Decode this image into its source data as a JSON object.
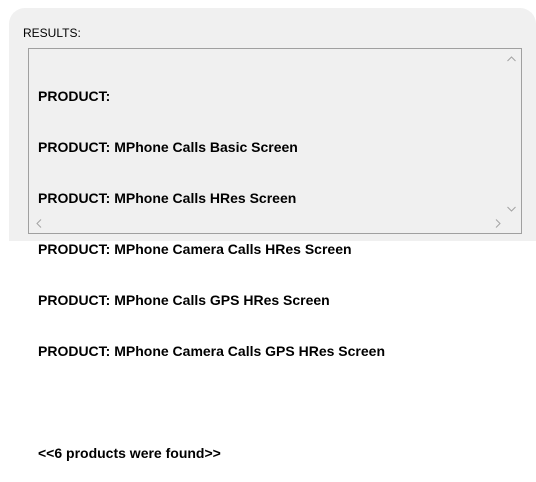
{
  "results": {
    "label": "RESULTS:",
    "lines": [
      "PRODUCT:",
      "PRODUCT: MPhone Calls Basic Screen",
      "PRODUCT: MPhone Calls HRes Screen",
      "PRODUCT: MPhone Camera Calls HRes Screen",
      "PRODUCT: MPhone Calls GPS HRes Screen",
      "PRODUCT: MPhone Camera Calls GPS HRes Screen",
      "",
      "<<6 products were found>>"
    ]
  },
  "scrollbar_icons": {
    "up": "chevron-up-icon",
    "down": "chevron-down-icon",
    "left": "chevron-left-icon",
    "right": "chevron-right-icon"
  },
  "colors": {
    "panel_bg": "#f0f0f0",
    "border": "#a0a0a0",
    "text": "#000000",
    "arrow": "#a3a3a3"
  }
}
